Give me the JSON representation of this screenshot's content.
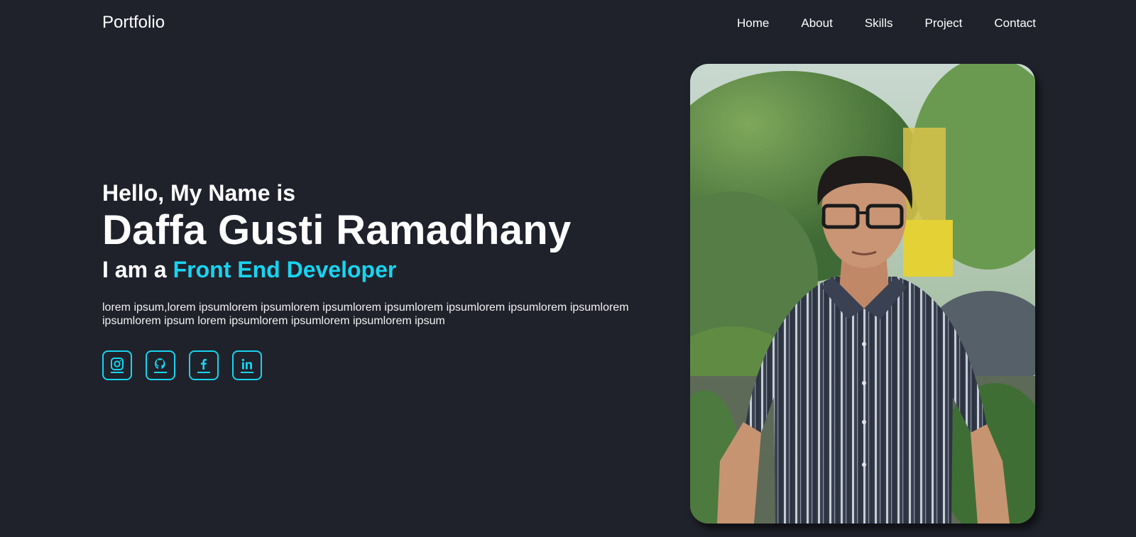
{
  "header": {
    "brand": "Portfolio",
    "nav": [
      "Home",
      "About",
      "Skills",
      "Project",
      "Contact"
    ]
  },
  "hero": {
    "greeting": "Hello, My Name is",
    "name": "Daffa Gusti Ramadhany",
    "role_prefix": "I am a",
    "role_highlight": "Front End Developer",
    "description": "lorem ipsum,lorem ipsumlorem ipsumlorem ipsumlorem ipsumlorem ipsumlorem ipsumlorem ipsumlorem ipsumlorem ipsum lorem ipsumlorem ipsumlorem ipsumlorem ipsum"
  },
  "socials": [
    {
      "icon": "instagram-icon"
    },
    {
      "icon": "github-icon"
    },
    {
      "icon": "facebook-icon"
    },
    {
      "icon": "linkedin-icon"
    }
  ],
  "colors": {
    "background": "#1f222b",
    "accent": "#17d4f0",
    "text": "#ffffff"
  }
}
